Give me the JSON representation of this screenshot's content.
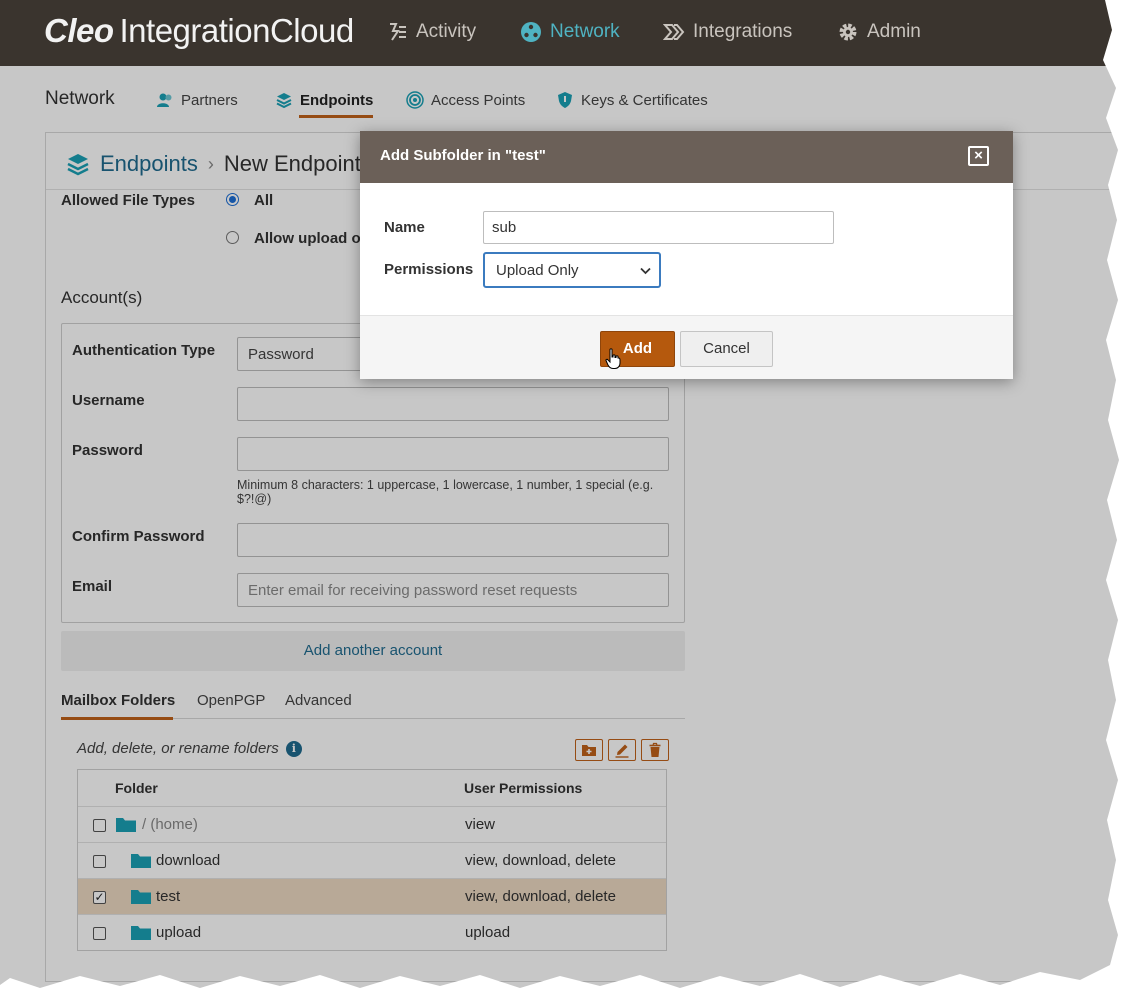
{
  "app": {
    "brand": "Cleo",
    "product": "IntegrationCloud"
  },
  "topnav": [
    {
      "label": "Activity",
      "icon": "activity-icon"
    },
    {
      "label": "Network",
      "icon": "network-icon",
      "active": true
    },
    {
      "label": "Integrations",
      "icon": "integrations-icon"
    },
    {
      "label": "Admin",
      "icon": "gear-icon"
    }
  ],
  "subnav": {
    "title": "Network",
    "tabs": [
      {
        "label": "Partners",
        "icon": "partners-icon"
      },
      {
        "label": "Endpoints",
        "icon": "layers-icon",
        "active": true
      },
      {
        "label": "Access Points",
        "icon": "access-point-icon"
      },
      {
        "label": "Keys & Certificates",
        "icon": "shield-icon"
      }
    ]
  },
  "breadcrumb": {
    "parent": "Endpoints",
    "sep": "›",
    "current": "New Endpoint"
  },
  "form": {
    "allowed_file_types_label": "Allowed File Types",
    "option_all": "All",
    "option_allow_upload": "Allow upload o",
    "accounts_title": "Account(s)",
    "auth_type_label": "Authentication Type",
    "auth_type_value": "Password",
    "username_label": "Username",
    "username_value": "",
    "password_label": "Password",
    "password_value": "",
    "password_hint": "Minimum 8 characters: 1 uppercase, 1 lowercase, 1 number, 1 special (e.g. $?!@)",
    "confirm_label": "Confirm Password",
    "confirm_value": "",
    "email_label": "Email",
    "email_placeholder": "Enter email for receiving password reset requests",
    "add_account": "Add another account"
  },
  "tabs": [
    {
      "label": "Mailbox Folders",
      "active": true
    },
    {
      "label": "OpenPGP"
    },
    {
      "label": "Advanced"
    }
  ],
  "folders": {
    "hint": "Add, delete, or rename folders",
    "info_glyph": "i",
    "col_folder": "Folder",
    "col_perms": "User Permissions",
    "rows": [
      {
        "name": "/ (home)",
        "perms": "view",
        "checked": false,
        "level": 0
      },
      {
        "name": "download",
        "perms": "view, download, delete",
        "checked": false,
        "level": 1
      },
      {
        "name": "test",
        "perms": "view, download, delete",
        "checked": true,
        "level": 1
      },
      {
        "name": "upload",
        "perms": "upload",
        "checked": false,
        "level": 1
      }
    ],
    "check_glyph": "✓"
  },
  "modal": {
    "title": "Add Subfolder in \"test\"",
    "close_glyph": "×",
    "name_label": "Name",
    "name_value": "sub",
    "permissions_label": "Permissions",
    "permissions_value": "Upload Only",
    "add_label": "Add",
    "cancel_label": "Cancel"
  },
  "colors": {
    "topbar": "#3a342e",
    "accent": "#c0621a",
    "link": "#1f6b8f",
    "folder": "#1aa0b5",
    "modal_header": "#6b6058",
    "primary_button": "#b5590d"
  }
}
